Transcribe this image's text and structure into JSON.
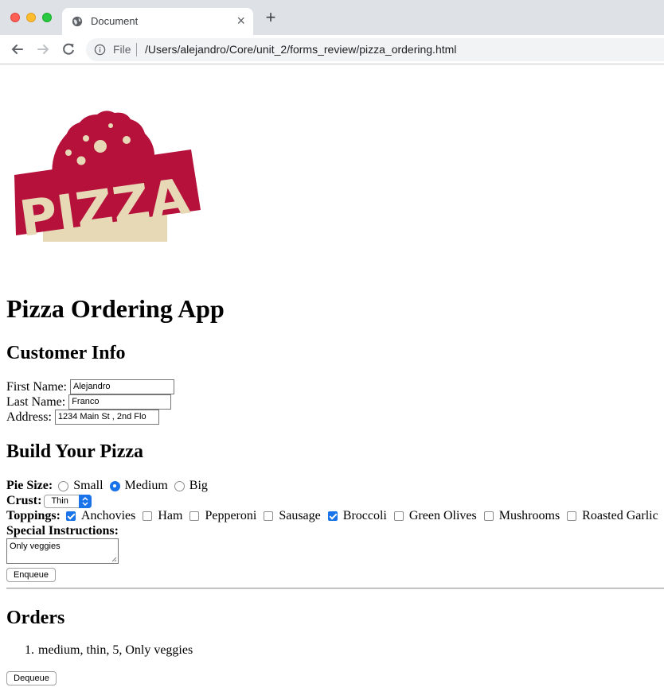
{
  "browser": {
    "tab_title": "Document",
    "tab_close": "×",
    "new_tab": "+",
    "omnibox_scheme": "File",
    "omnibox_url": "/Users/alejandro/Core/unit_2/forms_review/pizza_ordering.html"
  },
  "logo": {
    "text": "PIZZA",
    "colors": {
      "red": "#b5113a",
      "cream": "#e7d8b6"
    }
  },
  "page": {
    "title": "Pizza Ordering App",
    "customer_heading": "Customer Info",
    "first_name_label": "First Name:",
    "first_name_value": "Alejandro",
    "last_name_label": "Last Name:",
    "last_name_value": "Franco",
    "address_label": "Address:",
    "address_value": "1234 Main St , 2nd Flo",
    "build_heading": "Build Your Pizza",
    "pie_size_label": "Pie Size:",
    "pie_sizes": [
      {
        "label": "Small",
        "selected": false
      },
      {
        "label": "Medium",
        "selected": true
      },
      {
        "label": "Big",
        "selected": false
      }
    ],
    "crust_label": "Crust:",
    "crust_value": "Thin",
    "toppings_label": "Toppings:",
    "toppings": [
      {
        "label": "Anchovies",
        "checked": true
      },
      {
        "label": "Ham",
        "checked": false
      },
      {
        "label": "Pepperoni",
        "checked": false
      },
      {
        "label": "Sausage",
        "checked": false
      },
      {
        "label": "Broccoli",
        "checked": true
      },
      {
        "label": "Green Olives",
        "checked": false
      },
      {
        "label": "Mushrooms",
        "checked": false
      },
      {
        "label": "Roasted Garlic",
        "checked": false
      }
    ],
    "special_label": "Special Instructions:",
    "special_value": "Only veggies",
    "enqueue_label": "Enqueue",
    "orders_heading": "Orders",
    "orders": [
      {
        "number": "1.",
        "text": "medium, thin, 5, Only veggies"
      }
    ],
    "dequeue_label": "Dequeue"
  }
}
